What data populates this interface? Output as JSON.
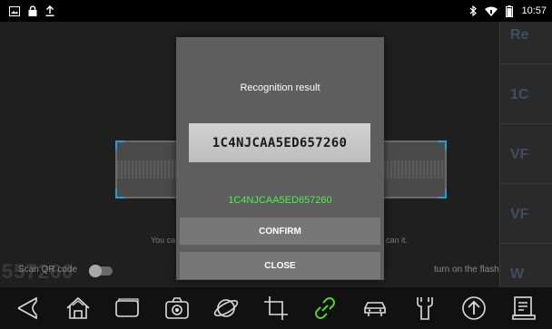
{
  "status_bar": {
    "time": "10:57",
    "left_icons": [
      "image-icon",
      "lock-icon",
      "upload-icon"
    ],
    "right_icons": [
      "bluetooth-icon",
      "wifi-icon",
      "battery-icon"
    ]
  },
  "camera": {
    "hint_left": "You ca",
    "hint_right": "can it.",
    "bg_text": "557260",
    "scan_qr_label": "Scan QR code",
    "flash_label": "turn on the flash",
    "scan_qr_on": false,
    "flash_on": false
  },
  "right_panel": {
    "items": [
      "Re",
      "1C",
      "VF",
      "VF",
      "W"
    ]
  },
  "dialog": {
    "title": "Recognition result",
    "vin_image_text": "1C4NJCAA5ED657260",
    "vin_result": "1C4NJCAA5ED657260",
    "confirm_label": "CONFIRM",
    "close_label": "CLOSE",
    "result_color": "#4cf04c"
  },
  "nav": {
    "items": [
      "back-icon",
      "home-icon",
      "recent-apps-icon",
      "camera-icon",
      "browser-icon",
      "crop-icon",
      "link-icon",
      "car-icon",
      "wrench-icon",
      "upload-circle-icon",
      "report-icon"
    ],
    "active_item": "link-icon",
    "active_color": "#4cd82e"
  }
}
